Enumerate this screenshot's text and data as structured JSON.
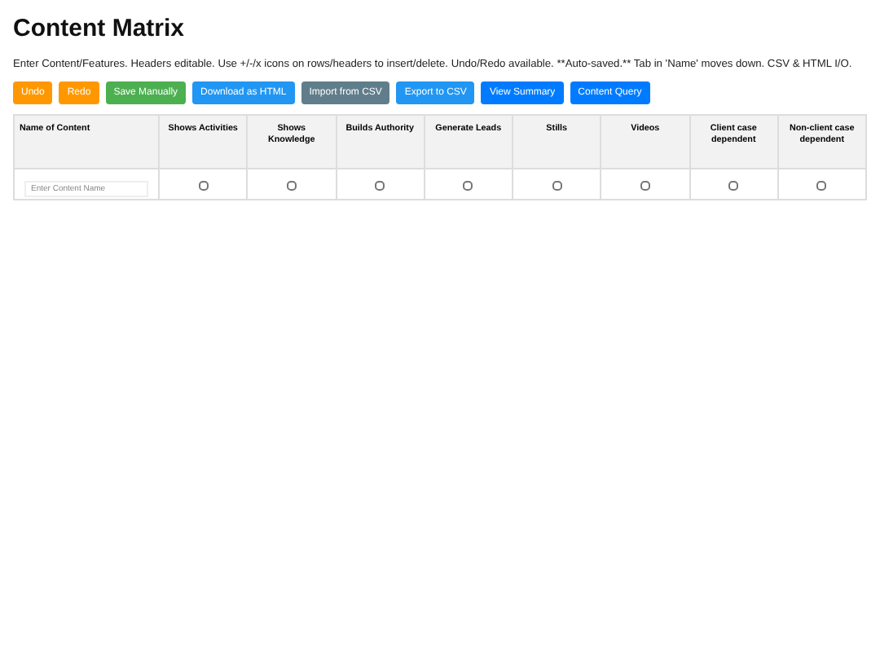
{
  "title": "Content Matrix",
  "description": "Enter Content/Features. Headers editable. Use +/-/x icons on rows/headers to insert/delete. Undo/Redo available. **Auto-saved.** Tab in 'Name' moves down. CSV & HTML I/O.",
  "buttons": [
    {
      "label": "Undo",
      "color": "#ff9800"
    },
    {
      "label": "Redo",
      "color": "#ff9800"
    },
    {
      "label": "Save Manually",
      "color": "#4caf50"
    },
    {
      "label": "Download as HTML",
      "color": "#2196f3"
    },
    {
      "label": "Import from CSV",
      "color": "#607d8b"
    },
    {
      "label": "Export to CSV",
      "color": "#2196f3"
    },
    {
      "label": "View Summary",
      "color": "#007bff"
    },
    {
      "label": "Content Query",
      "color": "#007bff"
    }
  ],
  "table": {
    "columns": [
      "Name of Content",
      "Shows Activities",
      "Shows Knowledge",
      "Builds Authority",
      "Generate Leads",
      "Stills",
      "Videos",
      "Client case dependent",
      "Non-client case dependent"
    ],
    "rows": [
      {
        "name": {
          "placeholder": "Enter Content Name"
        },
        "cells": [
          {
            "checked": false
          },
          {
            "checked": false
          },
          {
            "checked": false
          },
          {
            "checked": false
          },
          {
            "checked": false
          },
          {
            "checked": false
          },
          {
            "checked": false
          },
          {
            "checked": false
          }
        ]
      }
    ]
  }
}
